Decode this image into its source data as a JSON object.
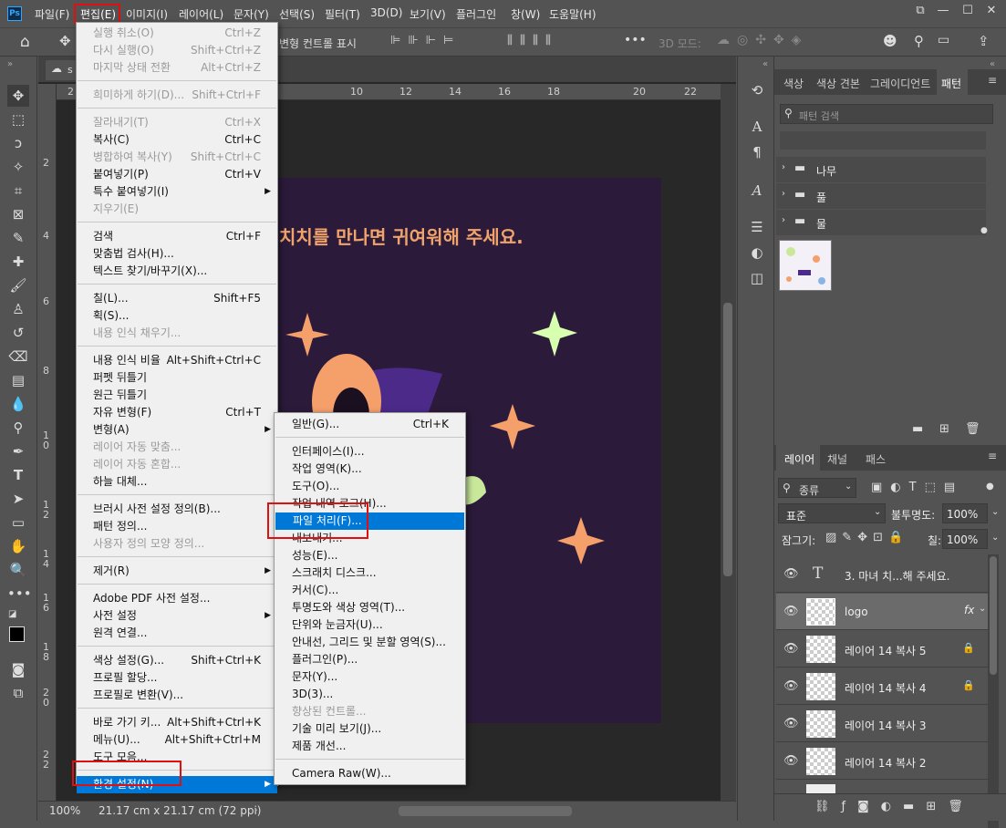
{
  "menubar": {
    "app_logo": "Ps",
    "items": [
      "파일(F)",
      "편집(E)",
      "이미지(I)",
      "레이어(L)",
      "문자(Y)",
      "선택(S)",
      "필터(T)",
      "3D(D)",
      "보기(V)",
      "플러그인",
      "창(W)",
      "도움말(H)"
    ],
    "window_buttons": [
      "⧉",
      "—",
      "☐",
      "✕"
    ]
  },
  "options_bar": {
    "transform_controls_label": "변형 컨트롤 표시",
    "mode_3d_label": "3D 모드:"
  },
  "document": {
    "tab_name": "s",
    "headline": "치치를 만나면 귀여워해 주세요.",
    "ruler_h": [
      "2",
      "10",
      "12",
      "14",
      "16",
      "18",
      "20",
      "22"
    ],
    "ruler_v": [
      "2",
      "4",
      "6",
      "8",
      "1\n0",
      "1\n2",
      "1\n4",
      "1\n6",
      "1\n8",
      "2\n0",
      "2\n2"
    ],
    "zoom": "100%",
    "size_info": "21.17 cm x 21.17 cm (72 ppi)"
  },
  "edit_menu": [
    {
      "label": "실행 취소(O)",
      "shortcut": "Ctrl+Z",
      "disabled": true
    },
    {
      "label": "다시 실행(O)",
      "shortcut": "Shift+Ctrl+Z",
      "disabled": true
    },
    {
      "label": "마지막 상태 전환",
      "shortcut": "Alt+Ctrl+Z",
      "disabled": true
    },
    {
      "sep": true
    },
    {
      "label": "희미하게 하기(D)...",
      "shortcut": "Shift+Ctrl+F",
      "disabled": true
    },
    {
      "sep": true
    },
    {
      "label": "잘라내기(T)",
      "shortcut": "Ctrl+X",
      "disabled": true
    },
    {
      "label": "복사(C)",
      "shortcut": "Ctrl+C"
    },
    {
      "label": "병합하여 복사(Y)",
      "shortcut": "Shift+Ctrl+C",
      "disabled": true
    },
    {
      "label": "붙여넣기(P)",
      "shortcut": "Ctrl+V"
    },
    {
      "label": "특수 붙여넣기(I)",
      "submenu": true
    },
    {
      "label": "지우기(E)",
      "disabled": true
    },
    {
      "sep": true
    },
    {
      "label": "검색",
      "shortcut": "Ctrl+F"
    },
    {
      "label": "맞춤법 검사(H)..."
    },
    {
      "label": "텍스트 찾기/바꾸기(X)..."
    },
    {
      "sep": true
    },
    {
      "label": "칠(L)...",
      "shortcut": "Shift+F5"
    },
    {
      "label": "획(S)..."
    },
    {
      "label": "내용 인식 채우기...",
      "disabled": true
    },
    {
      "sep": true
    },
    {
      "label": "내용 인식 비율",
      "shortcut": "Alt+Shift+Ctrl+C"
    },
    {
      "label": "퍼펫 뒤틀기"
    },
    {
      "label": "원근 뒤틀기"
    },
    {
      "label": "자유 변형(F)",
      "shortcut": "Ctrl+T"
    },
    {
      "label": "변형(A)",
      "submenu": true
    },
    {
      "label": "레이어 자동 맞춤...",
      "disabled": true
    },
    {
      "label": "레이어 자동 혼합...",
      "disabled": true
    },
    {
      "label": "하늘 대체..."
    },
    {
      "sep": true
    },
    {
      "label": "브러시 사전 설정 정의(B)..."
    },
    {
      "label": "패턴 정의..."
    },
    {
      "label": "사용자 정의 모양 정의...",
      "disabled": true
    },
    {
      "sep": true
    },
    {
      "label": "제거(R)",
      "submenu": true
    },
    {
      "sep": true
    },
    {
      "label": "Adobe PDF 사전 설정..."
    },
    {
      "label": "사전 설정",
      "submenu": true
    },
    {
      "label": "원격 연결..."
    },
    {
      "sep": true
    },
    {
      "label": "색상 설정(G)...",
      "shortcut": "Shift+Ctrl+K"
    },
    {
      "label": "프로필 할당..."
    },
    {
      "label": "프로필로 변환(V)..."
    },
    {
      "sep": true
    },
    {
      "label": "바로 가기 키...",
      "shortcut": "Alt+Shift+Ctrl+K"
    },
    {
      "label": "메뉴(U)...",
      "shortcut": "Alt+Shift+Ctrl+M"
    },
    {
      "label": "도구 모음..."
    },
    {
      "sep": true
    },
    {
      "label": "환경 설정(N)",
      "submenu": true,
      "highlighted": true
    }
  ],
  "prefs_submenu": [
    {
      "label": "일반(G)...",
      "shortcut": "Ctrl+K"
    },
    {
      "sep": true
    },
    {
      "label": "인터페이스(I)..."
    },
    {
      "label": "작업 영역(K)..."
    },
    {
      "label": "도구(O)..."
    },
    {
      "label": "작업 내역 로그(H)..."
    },
    {
      "label": "파일 처리(F)...",
      "highlighted": true
    },
    {
      "label": "내보내기..."
    },
    {
      "label": "성능(E)..."
    },
    {
      "label": "스크래치 디스크..."
    },
    {
      "label": "커서(C)..."
    },
    {
      "label": "투명도와 색상 영역(T)..."
    },
    {
      "label": "단위와 눈금자(U)..."
    },
    {
      "label": "안내선, 그리드 및 분할 영역(S)..."
    },
    {
      "label": "플러그인(P)..."
    },
    {
      "label": "문자(Y)..."
    },
    {
      "label": "3D(3)..."
    },
    {
      "label": "향상된 컨트롤...",
      "disabled": true
    },
    {
      "label": "기술 미리 보기(J)..."
    },
    {
      "label": "제품 개선..."
    },
    {
      "sep": true
    },
    {
      "label": "Camera Raw(W)..."
    }
  ],
  "swatch_panel": {
    "tabs": [
      "색상",
      "색상 견본",
      "그레이디언트",
      "패턴"
    ],
    "active_tab": "패턴",
    "search_placeholder": "패턴 검색",
    "folders": [
      "나무",
      "풀",
      "물"
    ]
  },
  "layers_panel": {
    "tabs": [
      "레이어",
      "채널",
      "패스"
    ],
    "kind_label": "종류",
    "blend_mode": "표준",
    "opacity_label": "불투명도:",
    "opacity_value": "100%",
    "lock_label": "잠그기:",
    "fill_label": "칠:",
    "fill_value": "100%",
    "layers": [
      {
        "name": "3. 마녀 치...해 주세요.",
        "type": "text",
        "locked": false
      },
      {
        "name": "logo",
        "type": "image",
        "fx": "fx",
        "locked": false,
        "selected": true
      },
      {
        "name": "레이어 14 복사 5",
        "type": "image",
        "locked": true
      },
      {
        "name": "레이어 14 복사 4",
        "type": "image",
        "locked": true
      },
      {
        "name": "레이어 14 복사 3",
        "type": "image",
        "locked": false
      },
      {
        "name": "레이어 14 복사 2",
        "type": "image",
        "locked": false
      }
    ]
  },
  "colors": {
    "menu_highlight": "#0078d7",
    "annotation_red": "#e01010",
    "doc_bg": "#2b1a3a",
    "headline": "#f0a46b"
  }
}
